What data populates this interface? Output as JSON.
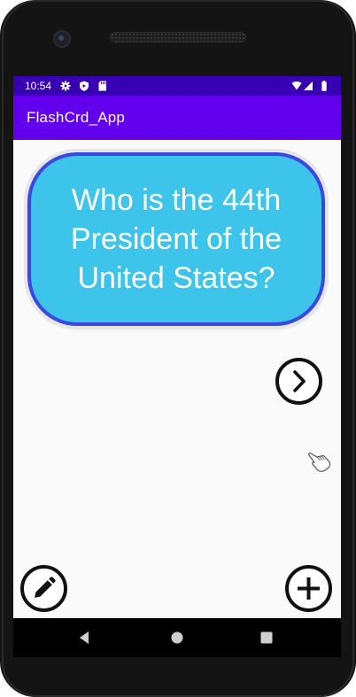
{
  "status_bar": {
    "time": "10:54",
    "icons_left": [
      "gear-icon",
      "shield-icon",
      "sd-card-icon"
    ],
    "icons_right": [
      "wifi-icon",
      "signal-icon",
      "battery-icon"
    ],
    "background": "#3700b3"
  },
  "app_bar": {
    "title": "FlashCrd_App",
    "background": "#6200ee"
  },
  "card": {
    "question": "Who is the 44th President of the United States?",
    "fill": "#3cc4ea",
    "border": "#3a48e2"
  },
  "buttons": {
    "next": "chevron-right-icon",
    "edit": "pencil-icon",
    "add": "plus-icon"
  },
  "nav_bar": {
    "back": "back-triangle-icon",
    "home": "home-circle-icon",
    "recents": "recents-square-icon"
  }
}
